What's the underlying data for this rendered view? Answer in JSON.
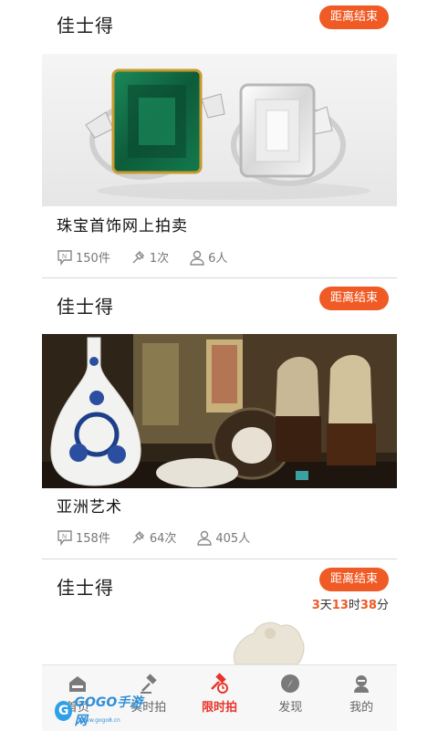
{
  "cards": [
    {
      "house": "佳士得",
      "badge": "距离结束",
      "title": "珠宝首饰网上拍卖",
      "lots": "150件",
      "bids": "1次",
      "people": "6人"
    },
    {
      "house": "佳士得",
      "badge": "距离结束",
      "title": "亚洲艺术",
      "lots": "158件",
      "bids": "64次",
      "people": "405人"
    },
    {
      "house": "佳士得",
      "badge": "距离结束",
      "countdown": {
        "days": "3",
        "days_unit": "天",
        "hours": "13",
        "hours_unit": "时",
        "minutes": "38",
        "minutes_unit": "分"
      }
    }
  ],
  "tabbar": {
    "items": [
      {
        "label": "首页",
        "icon": "home-icon"
      },
      {
        "label": "实时拍",
        "icon": "gavel-icon"
      },
      {
        "label": "限时拍",
        "icon": "timed-auction-icon",
        "active": true
      },
      {
        "label": "发现",
        "icon": "compass-icon"
      },
      {
        "label": "我的",
        "icon": "user-icon"
      }
    ]
  },
  "watermark": {
    "letter": "G",
    "text": "GOGO手游网",
    "sub": "www.gogo8.cn"
  },
  "colors": {
    "accent": "#f05a24",
    "active_tab": "#e8342a"
  }
}
